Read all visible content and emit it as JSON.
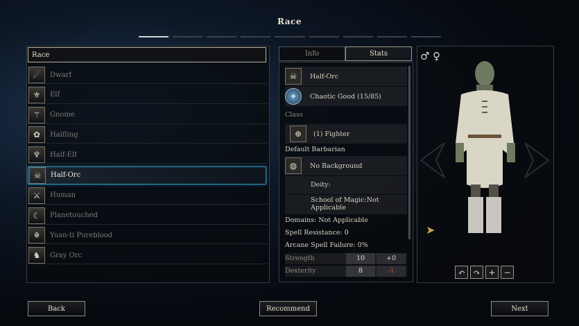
{
  "screen_title": "Race",
  "steps": [
    true,
    false,
    false,
    false,
    false,
    false,
    false,
    false,
    false
  ],
  "race_header": "Race",
  "races": [
    {
      "label": "Dwarf",
      "icon": "☄",
      "selected": false
    },
    {
      "label": "Elf",
      "icon": "⚜",
      "selected": false
    },
    {
      "label": "Gnome",
      "icon": "⚚",
      "selected": false
    },
    {
      "label": "Halfling",
      "icon": "✿",
      "selected": false
    },
    {
      "label": "Half-Elf",
      "icon": "♆",
      "selected": false
    },
    {
      "label": "Half-Orc",
      "icon": "☠",
      "selected": true
    },
    {
      "label": "Human",
      "icon": "⚔",
      "selected": false
    },
    {
      "label": "Planetouched",
      "icon": "☾",
      "selected": false
    },
    {
      "label": "Yuan-ti Pureblood",
      "icon": "☬",
      "selected": false
    },
    {
      "label": "Gray Orc",
      "icon": "♞",
      "selected": false
    }
  ],
  "tabs": {
    "info": "Info",
    "stats": "Stats"
  },
  "stats_panel": {
    "race_name": "Half-Orc",
    "alignment": "Chaotic Good (15/85)",
    "class_heading": "Class",
    "class_value": "(1) Fighter",
    "default_package": "Default Barbarian",
    "background": "No Background",
    "deity": "Deity:",
    "school": "School of Magic:Not Applicable",
    "domains": "Domains: Not Applicable",
    "spell_resistance": "Spell Resistance: 0",
    "arcane_failure": "Arcane Spell Failure: 0%",
    "abilities": [
      {
        "name": "Strength",
        "value": "10",
        "mod": "+0",
        "mod_color": "#d8d2c2"
      },
      {
        "name": "Dexterity",
        "value": "8",
        "mod": "-1",
        "mod_color": "#d4463a"
      }
    ]
  },
  "gender_symbols": {
    "male": "♂",
    "female": "♀"
  },
  "camera_controls": [
    "↶",
    "↷",
    "+",
    "−"
  ],
  "buttons": {
    "back": "Back",
    "recommend": "Recommend",
    "next": "Next"
  }
}
